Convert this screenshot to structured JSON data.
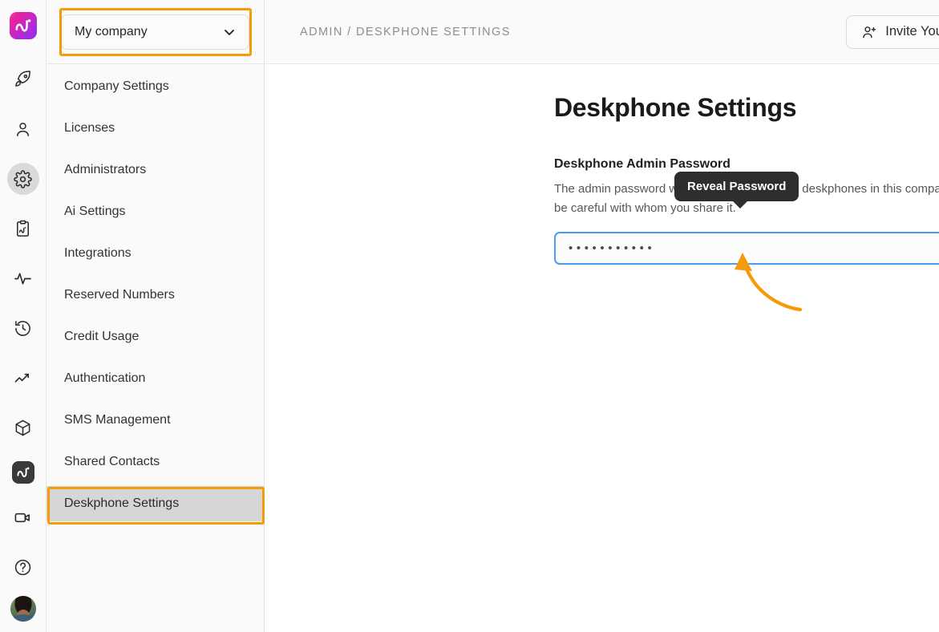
{
  "rail": {
    "logo_name": "app-logo",
    "icons": [
      {
        "name": "rocket-icon",
        "label": "Get Started"
      },
      {
        "name": "person-icon",
        "label": "Contacts"
      },
      {
        "name": "gear-icon",
        "label": "Settings"
      },
      {
        "name": "clipboard-ai-icon",
        "label": "Ai Notes"
      },
      {
        "name": "activity-pulse-icon",
        "label": "Activity"
      },
      {
        "name": "history-clock-icon",
        "label": "History"
      },
      {
        "name": "trending-up-icon",
        "label": "Analytics"
      },
      {
        "name": "box-icon",
        "label": "Apps"
      },
      {
        "name": "ai-badge-icon",
        "label": "Ai Assistant"
      },
      {
        "name": "video-camera-icon",
        "label": "Meetings"
      },
      {
        "name": "help-circle-icon",
        "label": "Help"
      }
    ],
    "avatar_label": "User profile"
  },
  "sidebar": {
    "company": {
      "selected": "My company",
      "chevron": "chevron-down-icon"
    },
    "items": [
      {
        "label": "Company Settings",
        "selected": false
      },
      {
        "label": "Licenses",
        "selected": false
      },
      {
        "label": "Administrators",
        "selected": false
      },
      {
        "label": "Ai Settings",
        "selected": false
      },
      {
        "label": "Integrations",
        "selected": false
      },
      {
        "label": "Reserved Numbers",
        "selected": false
      },
      {
        "label": "Credit Usage",
        "selected": false
      },
      {
        "label": "Authentication",
        "selected": false
      },
      {
        "label": "SMS Management",
        "selected": false
      },
      {
        "label": "Shared Contacts",
        "selected": false
      },
      {
        "label": "Deskphone Settings",
        "selected": true
      }
    ]
  },
  "topbar": {
    "breadcrumb": "ADMIN / DESKPHONE SETTINGS",
    "invite_label": "Invite Your Team",
    "invite_icon": "person-plus-icon"
  },
  "main": {
    "page_title": "Deskphone Settings",
    "password_section": {
      "label": "Deskphone Admin Password",
      "description": "The admin password will work for all activated deskphones in this company. Please be careful with whom you share it.",
      "value_masked": "•••••••••••",
      "reveal_icon": "eye-off-icon"
    }
  },
  "tooltip": {
    "text": "Reveal Password"
  },
  "annotations": {
    "color": "#f59a0b",
    "highlight_company_selector": "My company",
    "highlight_menu_item": "Deskphone Settings",
    "arrow_points_to": "reveal-password-button"
  }
}
